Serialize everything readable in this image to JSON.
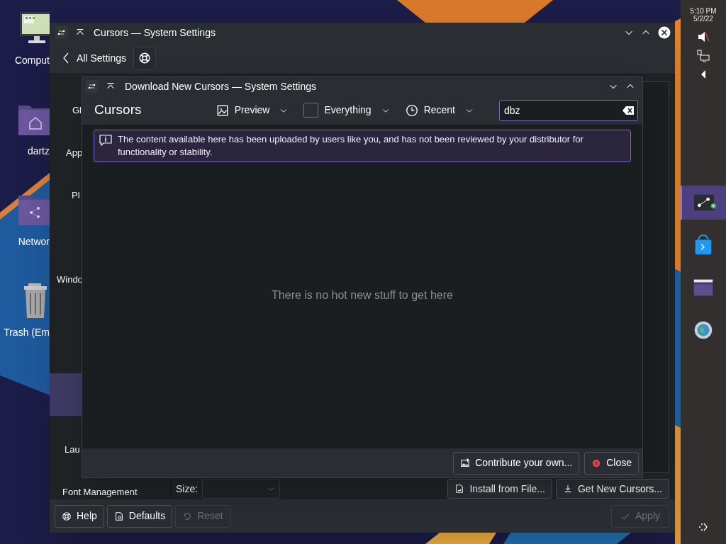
{
  "desktop_icons": [
    {
      "kind": "computer",
      "label": "Comput"
    },
    {
      "kind": "home-folder",
      "label": "dartz"
    },
    {
      "kind": "network-folder",
      "label": "Networ"
    },
    {
      "kind": "trash",
      "label": "Trash (Em"
    }
  ],
  "settings_window": {
    "title": "Cursors — System Settings",
    "back_label": "All Settings",
    "sidebar": {
      "items": [
        {
          "label": "Gl",
          "selected": false
        },
        {
          "label": "App",
          "selected": false
        },
        {
          "label": "Pl",
          "selected": false
        },
        {
          "label": "Windo",
          "selected": false
        },
        {
          "selected": true
        },
        {
          "label": "Lau",
          "selected": false
        },
        {
          "label": "Font Management",
          "selected": false
        }
      ]
    },
    "size_label": "Size:",
    "content_buttons": [
      {
        "kind": "install",
        "label": "Install from File...",
        "disabled": false
      },
      {
        "kind": "download",
        "label": "Get New Cursors...",
        "disabled": false
      }
    ],
    "footer_buttons": [
      {
        "kind": "help",
        "label": "Help",
        "disabled": false
      },
      {
        "kind": "defaults",
        "label": "Defaults",
        "disabled": false
      },
      {
        "kind": "reset",
        "label": "Reset",
        "disabled": true
      }
    ],
    "apply_button": {
      "label": "Apply",
      "disabled": true
    }
  },
  "dialog": {
    "title": "Download New Cursors — System Settings",
    "heading": "Cursors",
    "filters": [
      {
        "kind": "dropdown",
        "label": "Preview"
      },
      {
        "kind": "checkbox",
        "label": "Everything",
        "checked": false
      },
      {
        "kind": "dropdown",
        "label": "Recent"
      }
    ],
    "search": {
      "value": "dbz"
    },
    "notice": "The content available here has been uploaded by users like you, and has not been reviewed by your distributor for functionality or stability.",
    "empty_message": "There is no hot new stuff to get here",
    "buttons": [
      {
        "kind": "contribute",
        "label": "Contribute your own..."
      },
      {
        "kind": "close",
        "label": "Close"
      }
    ]
  },
  "panel": {
    "time": "5:10 PM",
    "date": "5/2/22",
    "tasks": [
      {
        "kind": "settings",
        "selected": true
      },
      {
        "kind": "store",
        "selected": false
      },
      {
        "kind": "files",
        "selected": false
      },
      {
        "kind": "browser",
        "selected": false
      }
    ]
  }
}
